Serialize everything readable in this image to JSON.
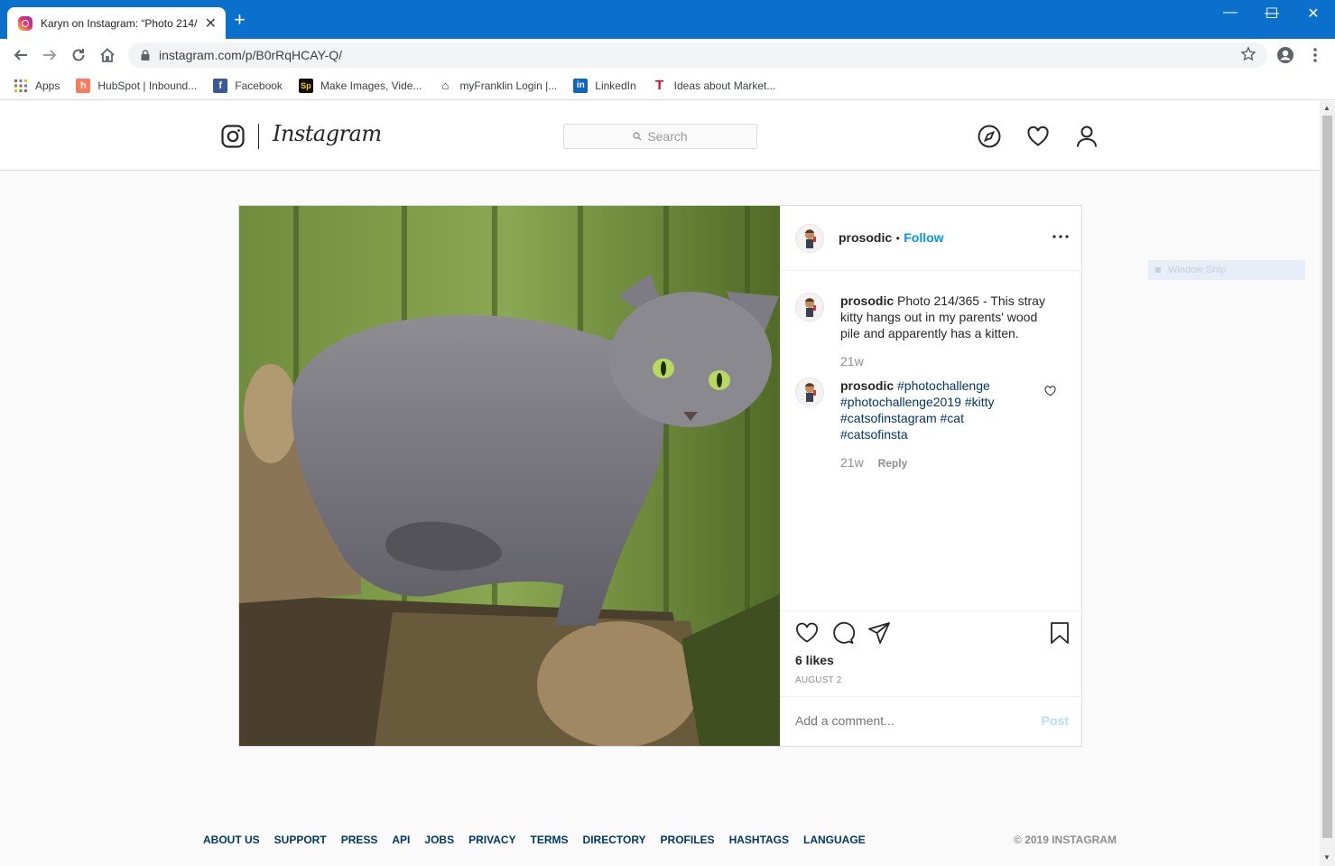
{
  "browser": {
    "tab_title": "Karyn on Instagram: “Photo 214/",
    "new_tab": "+",
    "url": "instagram.com/p/B0rRqHCAY-Q/",
    "bookmarks": [
      {
        "label": "Apps"
      },
      {
        "label": "HubSpot | Inbound..."
      },
      {
        "label": "Facebook"
      },
      {
        "label": "Make Images, Vide..."
      },
      {
        "label": "myFranklin Login |..."
      },
      {
        "label": "LinkedIn"
      },
      {
        "label": "Ideas about Market..."
      }
    ]
  },
  "instagram": {
    "wordmark": "Instagram",
    "search_placeholder": "Search",
    "post": {
      "username": "prosodic",
      "separator": "•",
      "follow": "Follow",
      "more": "•••",
      "caption": {
        "user": "prosodic",
        "text": "Photo 214/365 - This stray kitty hangs out in my parents' wood pile and apparently has a kitten.",
        "age": "21w"
      },
      "comment": {
        "user": "prosodic",
        "tags": [
          "#photochallenge",
          "#photochallenge2019",
          "#kitty",
          "#catsofinstagram",
          "#cat",
          "#catsofinsta"
        ],
        "age": "21w",
        "reply": "Reply"
      },
      "likes": "6 likes",
      "date": "AUGUST 2",
      "comment_placeholder": "Add a comment...",
      "post_button": "Post"
    },
    "footer": {
      "links": [
        "ABOUT US",
        "SUPPORT",
        "PRESS",
        "API",
        "JOBS",
        "PRIVACY",
        "TERMS",
        "DIRECTORY",
        "PROFILES",
        "HASHTAGS",
        "LANGUAGE"
      ],
      "copyright": "© 2019 INSTAGRAM"
    }
  },
  "overlay": {
    "window_snip": "Window Snip"
  }
}
